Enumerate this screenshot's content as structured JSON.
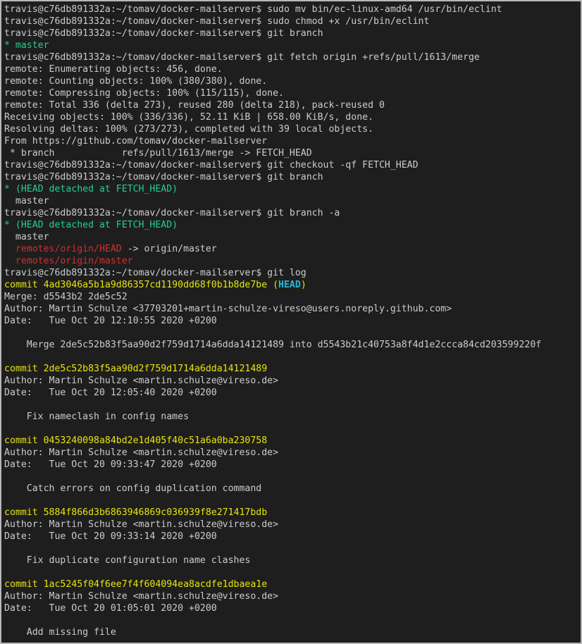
{
  "terminal": {
    "lines": [
      {
        "segs": [
          {
            "t": "travis@c76db891332a:~/tomav/docker-mailserver$ sudo mv bin/ec-linux-amd64 /usr/bin/eclint",
            "c": "default"
          }
        ]
      },
      {
        "segs": [
          {
            "t": "travis@c76db891332a:~/tomav/docker-mailserver$ sudo chmod +x /usr/bin/eclint",
            "c": "default"
          }
        ]
      },
      {
        "segs": [
          {
            "t": "travis@c76db891332a:~/tomav/docker-mailserver$ git branch",
            "c": "default"
          }
        ]
      },
      {
        "segs": [
          {
            "t": "* master",
            "c": "green"
          }
        ]
      },
      {
        "segs": [
          {
            "t": "travis@c76db891332a:~/tomav/docker-mailserver$ git fetch origin +refs/pull/1613/merge",
            "c": "default"
          }
        ]
      },
      {
        "segs": [
          {
            "t": "remote: Enumerating objects: 456, done.",
            "c": "default"
          }
        ]
      },
      {
        "segs": [
          {
            "t": "remote: Counting objects: 100% (380/380), done.",
            "c": "default"
          }
        ]
      },
      {
        "segs": [
          {
            "t": "remote: Compressing objects: 100% (115/115), done.",
            "c": "default"
          }
        ]
      },
      {
        "segs": [
          {
            "t": "remote: Total 336 (delta 273), reused 280 (delta 218), pack-reused 0",
            "c": "default"
          }
        ]
      },
      {
        "segs": [
          {
            "t": "Receiving objects: 100% (336/336), 52.11 KiB | 658.00 KiB/s, done.",
            "c": "default"
          }
        ]
      },
      {
        "segs": [
          {
            "t": "Resolving deltas: 100% (273/273), completed with 39 local objects.",
            "c": "default"
          }
        ]
      },
      {
        "segs": [
          {
            "t": "From https://github.com/tomav/docker-mailserver",
            "c": "default"
          }
        ]
      },
      {
        "segs": [
          {
            "t": " * branch            refs/pull/1613/merge -> FETCH_HEAD",
            "c": "default"
          }
        ]
      },
      {
        "segs": [
          {
            "t": "travis@c76db891332a:~/tomav/docker-mailserver$ git checkout -qf FETCH_HEAD",
            "c": "default"
          }
        ]
      },
      {
        "segs": [
          {
            "t": "travis@c76db891332a:~/tomav/docker-mailserver$ git branch",
            "c": "default"
          }
        ]
      },
      {
        "segs": [
          {
            "t": "* (HEAD detached at FETCH_HEAD)",
            "c": "green"
          }
        ]
      },
      {
        "segs": [
          {
            "t": "  master",
            "c": "default"
          }
        ]
      },
      {
        "segs": [
          {
            "t": "travis@c76db891332a:~/tomav/docker-mailserver$ git branch -a",
            "c": "default"
          }
        ]
      },
      {
        "segs": [
          {
            "t": "* (HEAD detached at FETCH_HEAD)",
            "c": "green"
          }
        ]
      },
      {
        "segs": [
          {
            "t": "  master",
            "c": "default"
          }
        ]
      },
      {
        "segs": [
          {
            "t": "  ",
            "c": "default"
          },
          {
            "t": "remotes/origin/HEAD",
            "c": "red"
          },
          {
            "t": " -> origin/master",
            "c": "default"
          }
        ]
      },
      {
        "segs": [
          {
            "t": "  ",
            "c": "default"
          },
          {
            "t": "remotes/origin/master",
            "c": "red"
          }
        ]
      },
      {
        "segs": [
          {
            "t": "travis@c76db891332a:~/tomav/docker-mailserver$ git log",
            "c": "default"
          }
        ]
      },
      {
        "segs": [
          {
            "t": "commit 4ad3046a5b1a9d86357cd1190dd68f0b1b8de7be (",
            "c": "yellow"
          },
          {
            "t": "HEAD",
            "c": "cyan-bold"
          },
          {
            "t": ")",
            "c": "yellow"
          }
        ]
      },
      {
        "segs": [
          {
            "t": "Merge: d5543b2 2de5c52",
            "c": "default"
          }
        ]
      },
      {
        "segs": [
          {
            "t": "Author: Martin Schulze <37703201+martin-schulze-vireso@users.noreply.github.com>",
            "c": "default"
          }
        ]
      },
      {
        "segs": [
          {
            "t": "Date:   Tue Oct 20 12:10:55 2020 +0200",
            "c": "default"
          }
        ]
      },
      {
        "segs": [
          {
            "t": "",
            "c": "default"
          }
        ]
      },
      {
        "segs": [
          {
            "t": "    Merge 2de5c52b83f5aa90d2f759d1714a6dda14121489 into d5543b21c40753a8f4d1e2ccca84cd203599220f",
            "c": "default"
          }
        ]
      },
      {
        "segs": [
          {
            "t": "",
            "c": "default"
          }
        ]
      },
      {
        "segs": [
          {
            "t": "commit 2de5c52b83f5aa90d2f759d1714a6dda14121489",
            "c": "yellow"
          }
        ]
      },
      {
        "segs": [
          {
            "t": "Author: Martin Schulze <martin.schulze@vireso.de>",
            "c": "default"
          }
        ]
      },
      {
        "segs": [
          {
            "t": "Date:   Tue Oct 20 12:05:40 2020 +0200",
            "c": "default"
          }
        ]
      },
      {
        "segs": [
          {
            "t": "",
            "c": "default"
          }
        ]
      },
      {
        "segs": [
          {
            "t": "    Fix nameclash in config names",
            "c": "default"
          }
        ]
      },
      {
        "segs": [
          {
            "t": "",
            "c": "default"
          }
        ]
      },
      {
        "segs": [
          {
            "t": "commit 0453240098a84bd2e1d405f40c51a6a0ba230758",
            "c": "yellow"
          }
        ]
      },
      {
        "segs": [
          {
            "t": "Author: Martin Schulze <martin.schulze@vireso.de>",
            "c": "default"
          }
        ]
      },
      {
        "segs": [
          {
            "t": "Date:   Tue Oct 20 09:33:47 2020 +0200",
            "c": "default"
          }
        ]
      },
      {
        "segs": [
          {
            "t": "",
            "c": "default"
          }
        ]
      },
      {
        "segs": [
          {
            "t": "    Catch errors on config duplication command",
            "c": "default"
          }
        ]
      },
      {
        "segs": [
          {
            "t": "",
            "c": "default"
          }
        ]
      },
      {
        "segs": [
          {
            "t": "commit 5884f866d3b6863946869c036939f8e271417bdb",
            "c": "yellow"
          }
        ]
      },
      {
        "segs": [
          {
            "t": "Author: Martin Schulze <martin.schulze@vireso.de>",
            "c": "default"
          }
        ]
      },
      {
        "segs": [
          {
            "t": "Date:   Tue Oct 20 09:33:14 2020 +0200",
            "c": "default"
          }
        ]
      },
      {
        "segs": [
          {
            "t": "",
            "c": "default"
          }
        ]
      },
      {
        "segs": [
          {
            "t": "    Fix duplicate configuration name clashes",
            "c": "default"
          }
        ]
      },
      {
        "segs": [
          {
            "t": "",
            "c": "default"
          }
        ]
      },
      {
        "segs": [
          {
            "t": "commit 1ac5245f04f6ee7f4f604094ea8acdfe1dbaea1e",
            "c": "yellow"
          }
        ]
      },
      {
        "segs": [
          {
            "t": "Author: Martin Schulze <martin.schulze@vireso.de>",
            "c": "default"
          }
        ]
      },
      {
        "segs": [
          {
            "t": "Date:   Tue Oct 20 01:05:01 2020 +0200",
            "c": "default"
          }
        ]
      },
      {
        "segs": [
          {
            "t": "",
            "c": "default"
          }
        ]
      },
      {
        "segs": [
          {
            "t": "    Add missing file",
            "c": "default"
          }
        ]
      }
    ]
  },
  "colors": {
    "background": "#1e1e1e",
    "default": "#cccccc",
    "green": "#23d18b",
    "red": "#cd3131",
    "yellow": "#e5e510",
    "cyan": "#29b8db"
  }
}
